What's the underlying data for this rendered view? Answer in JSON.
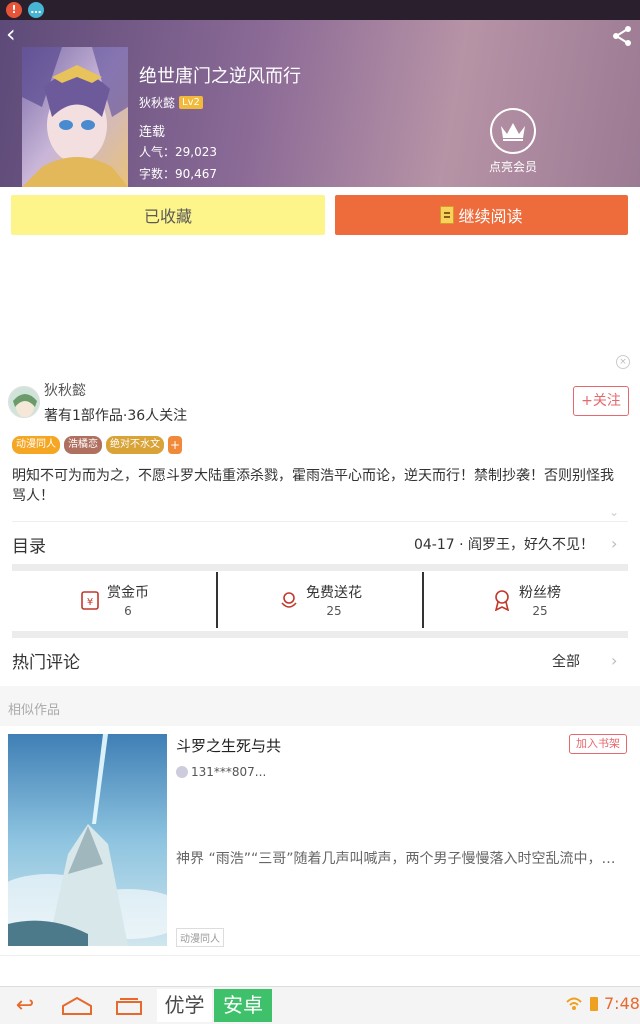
{
  "header": {
    "title": "绝世唐门之逆风而行",
    "author": "狄秋懿",
    "level": "Lv2",
    "status": "连载",
    "popularity": "人气：29,023",
    "words": "字数：90,467",
    "member_label": "点亮会员"
  },
  "actions": {
    "favorited_label": "已收藏",
    "continue_label": "继续阅读"
  },
  "author_block": {
    "name": "狄秋懿",
    "stats": "著有1部作品·36人关注",
    "follow_label": "+关注"
  },
  "tags": [
    "动漫同人",
    "浩橘恋",
    "绝对不水文"
  ],
  "tag_add": "+",
  "description": "明知不可为而为之，不愿斗罗大陆重添杀戮，霍雨浩平心而论，逆天而行！禁制抄袭！否则别怪我骂人！",
  "toc": {
    "label": "目录",
    "latest": "04-17 · 阎罗王，好久不见！"
  },
  "stats": [
    {
      "label": "赏金币",
      "value": "6",
      "icon": "coin-icon"
    },
    {
      "label": "免费送花",
      "value": "25",
      "icon": "flower-icon"
    },
    {
      "label": "粉丝榜",
      "value": "25",
      "icon": "medal-icon"
    }
  ],
  "hot_comments": {
    "label": "热门评论",
    "all_label": "全部"
  },
  "similar": {
    "label": "相似作品",
    "item": {
      "title": "斗罗之生死与共",
      "add_label": "加入书架",
      "user": "131***807...",
      "desc": "神界  “雨浩”“三哥”随着几声叫喊声，两个男子慢慢落入时空乱流中，…",
      "tag": "动漫同人"
    }
  },
  "navbar": {
    "brand_part1": "优学",
    "brand_part2": "安卓",
    "time": "7:48"
  },
  "colors": {
    "accent_orange": "#ee6c3b",
    "favorite_yellow": "#fdf48a",
    "follow_pink": "#e5686c",
    "brand_green": "#3fc06a"
  }
}
